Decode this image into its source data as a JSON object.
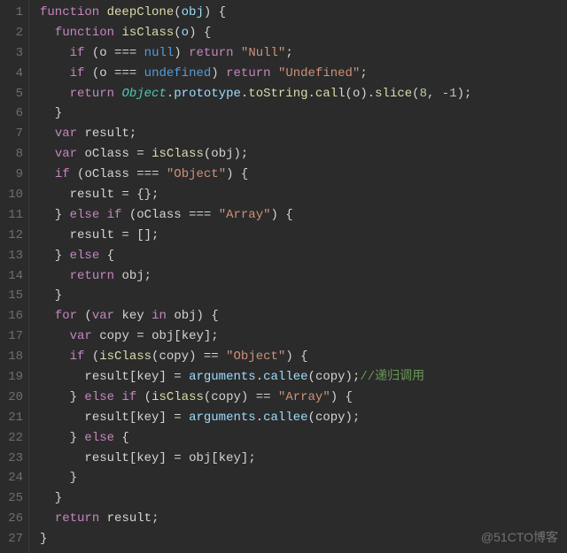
{
  "watermark": "@51CTO博客",
  "line_count": 27,
  "comment_recursive": "//递归调用",
  "code_lines": [
    [
      [
        "kw",
        "function"
      ],
      [
        "pun",
        " "
      ],
      [
        "fn",
        "deepClone"
      ],
      [
        "pun",
        "("
      ],
      [
        "param",
        "obj"
      ],
      [
        "pun",
        ") {"
      ]
    ],
    [
      [
        "pun",
        "  "
      ],
      [
        "kw",
        "function"
      ],
      [
        "pun",
        " "
      ],
      [
        "fn",
        "isClass"
      ],
      [
        "pun",
        "("
      ],
      [
        "param",
        "o"
      ],
      [
        "pun",
        ") {"
      ]
    ],
    [
      [
        "pun",
        "    "
      ],
      [
        "kw",
        "if"
      ],
      [
        "pun",
        " ("
      ],
      [
        "id",
        "o"
      ],
      [
        "pun",
        " "
      ],
      [
        "op",
        "==="
      ],
      [
        "pun",
        " "
      ],
      [
        "const",
        "null"
      ],
      [
        "pun",
        ") "
      ],
      [
        "kw",
        "return"
      ],
      [
        "pun",
        " "
      ],
      [
        "str",
        "\"Null\""
      ],
      [
        "pun",
        ";"
      ]
    ],
    [
      [
        "pun",
        "    "
      ],
      [
        "kw",
        "if"
      ],
      [
        "pun",
        " ("
      ],
      [
        "id",
        "o"
      ],
      [
        "pun",
        " "
      ],
      [
        "op",
        "==="
      ],
      [
        "pun",
        " "
      ],
      [
        "const",
        "undefined"
      ],
      [
        "pun",
        ") "
      ],
      [
        "kw",
        "return"
      ],
      [
        "pun",
        " "
      ],
      [
        "str",
        "\"Undefined\""
      ],
      [
        "pun",
        ";"
      ]
    ],
    [
      [
        "pun",
        "    "
      ],
      [
        "kw",
        "return"
      ],
      [
        "pun",
        " "
      ],
      [
        "obj",
        "Object"
      ],
      [
        "pun",
        "."
      ],
      [
        "prop",
        "prototype"
      ],
      [
        "pun",
        "."
      ],
      [
        "fn",
        "toString"
      ],
      [
        "pun",
        "."
      ],
      [
        "fn",
        "call"
      ],
      [
        "pun",
        "("
      ],
      [
        "id",
        "o"
      ],
      [
        "pun",
        ")."
      ],
      [
        "fn",
        "slice"
      ],
      [
        "pun",
        "("
      ],
      [
        "num",
        "8"
      ],
      [
        "pun",
        ", "
      ],
      [
        "num",
        "-1"
      ],
      [
        "pun",
        ");"
      ]
    ],
    [
      [
        "pun",
        "  }"
      ]
    ],
    [
      [
        "pun",
        "  "
      ],
      [
        "kw",
        "var"
      ],
      [
        "pun",
        " "
      ],
      [
        "id",
        "result"
      ],
      [
        "pun",
        ";"
      ]
    ],
    [
      [
        "pun",
        "  "
      ],
      [
        "kw",
        "var"
      ],
      [
        "pun",
        " "
      ],
      [
        "id",
        "oClass"
      ],
      [
        "pun",
        " = "
      ],
      [
        "fn",
        "isClass"
      ],
      [
        "pun",
        "("
      ],
      [
        "id",
        "obj"
      ],
      [
        "pun",
        ");"
      ]
    ],
    [
      [
        "pun",
        "  "
      ],
      [
        "kw",
        "if"
      ],
      [
        "pun",
        " ("
      ],
      [
        "id",
        "oClass"
      ],
      [
        "pun",
        " "
      ],
      [
        "op",
        "==="
      ],
      [
        "pun",
        " "
      ],
      [
        "str",
        "\"Object\""
      ],
      [
        "pun",
        ") {"
      ]
    ],
    [
      [
        "pun",
        "    "
      ],
      [
        "id",
        "result"
      ],
      [
        "pun",
        " = {};"
      ]
    ],
    [
      [
        "pun",
        "  } "
      ],
      [
        "kw",
        "else"
      ],
      [
        "pun",
        " "
      ],
      [
        "kw",
        "if"
      ],
      [
        "pun",
        " ("
      ],
      [
        "id",
        "oClass"
      ],
      [
        "pun",
        " "
      ],
      [
        "op",
        "==="
      ],
      [
        "pun",
        " "
      ],
      [
        "str",
        "\"Array\""
      ],
      [
        "pun",
        ") {"
      ]
    ],
    [
      [
        "pun",
        "    "
      ],
      [
        "id",
        "result"
      ],
      [
        "pun",
        " = [];"
      ]
    ],
    [
      [
        "pun",
        "  } "
      ],
      [
        "kw",
        "else"
      ],
      [
        "pun",
        " {"
      ]
    ],
    [
      [
        "pun",
        "    "
      ],
      [
        "kw",
        "return"
      ],
      [
        "pun",
        " "
      ],
      [
        "id",
        "obj"
      ],
      [
        "pun",
        ";"
      ]
    ],
    [
      [
        "pun",
        "  }"
      ]
    ],
    [
      [
        "pun",
        "  "
      ],
      [
        "kw",
        "for"
      ],
      [
        "pun",
        " ("
      ],
      [
        "kw",
        "var"
      ],
      [
        "pun",
        " "
      ],
      [
        "id",
        "key"
      ],
      [
        "pun",
        " "
      ],
      [
        "kw",
        "in"
      ],
      [
        "pun",
        " "
      ],
      [
        "id",
        "obj"
      ],
      [
        "pun",
        ") {"
      ]
    ],
    [
      [
        "pun",
        "    "
      ],
      [
        "kw",
        "var"
      ],
      [
        "pun",
        " "
      ],
      [
        "id",
        "copy"
      ],
      [
        "pun",
        " = "
      ],
      [
        "id",
        "obj"
      ],
      [
        "pun",
        "["
      ],
      [
        "id",
        "key"
      ],
      [
        "pun",
        "];"
      ]
    ],
    [
      [
        "pun",
        "    "
      ],
      [
        "kw",
        "if"
      ],
      [
        "pun",
        " ("
      ],
      [
        "fn",
        "isClass"
      ],
      [
        "pun",
        "("
      ],
      [
        "id",
        "copy"
      ],
      [
        "pun",
        ") "
      ],
      [
        "op",
        "=="
      ],
      [
        "pun",
        " "
      ],
      [
        "str",
        "\"Object\""
      ],
      [
        "pun",
        ") {"
      ]
    ],
    [
      [
        "pun",
        "      "
      ],
      [
        "id",
        "result"
      ],
      [
        "pun",
        "["
      ],
      [
        "id",
        "key"
      ],
      [
        "pun",
        "] = "
      ],
      [
        "prop",
        "arguments"
      ],
      [
        "pun",
        "."
      ],
      [
        "prop",
        "callee"
      ],
      [
        "pun",
        "("
      ],
      [
        "id",
        "copy"
      ],
      [
        "pun",
        ");"
      ],
      [
        "cmt",
        "//递归调用"
      ]
    ],
    [
      [
        "pun",
        "    } "
      ],
      [
        "kw",
        "else"
      ],
      [
        "pun",
        " "
      ],
      [
        "kw",
        "if"
      ],
      [
        "pun",
        " ("
      ],
      [
        "fn",
        "isClass"
      ],
      [
        "pun",
        "("
      ],
      [
        "id",
        "copy"
      ],
      [
        "pun",
        ") "
      ],
      [
        "op",
        "=="
      ],
      [
        "pun",
        " "
      ],
      [
        "str",
        "\"Array\""
      ],
      [
        "pun",
        ") {"
      ]
    ],
    [
      [
        "pun",
        "      "
      ],
      [
        "id",
        "result"
      ],
      [
        "pun",
        "["
      ],
      [
        "id",
        "key"
      ],
      [
        "pun",
        "] = "
      ],
      [
        "prop",
        "arguments"
      ],
      [
        "pun",
        "."
      ],
      [
        "prop",
        "callee"
      ],
      [
        "pun",
        "("
      ],
      [
        "id",
        "copy"
      ],
      [
        "pun",
        ");"
      ]
    ],
    [
      [
        "pun",
        "    } "
      ],
      [
        "kw",
        "else"
      ],
      [
        "pun",
        " {"
      ]
    ],
    [
      [
        "pun",
        "      "
      ],
      [
        "id",
        "result"
      ],
      [
        "pun",
        "["
      ],
      [
        "id",
        "key"
      ],
      [
        "pun",
        "] = "
      ],
      [
        "id",
        "obj"
      ],
      [
        "pun",
        "["
      ],
      [
        "id",
        "key"
      ],
      [
        "pun",
        "];"
      ]
    ],
    [
      [
        "pun",
        "    }"
      ]
    ],
    [
      [
        "pun",
        "  }"
      ]
    ],
    [
      [
        "pun",
        "  "
      ],
      [
        "kw",
        "return"
      ],
      [
        "pun",
        " "
      ],
      [
        "id",
        "result"
      ],
      [
        "pun",
        ";"
      ]
    ],
    [
      [
        "pun",
        "}"
      ]
    ]
  ]
}
